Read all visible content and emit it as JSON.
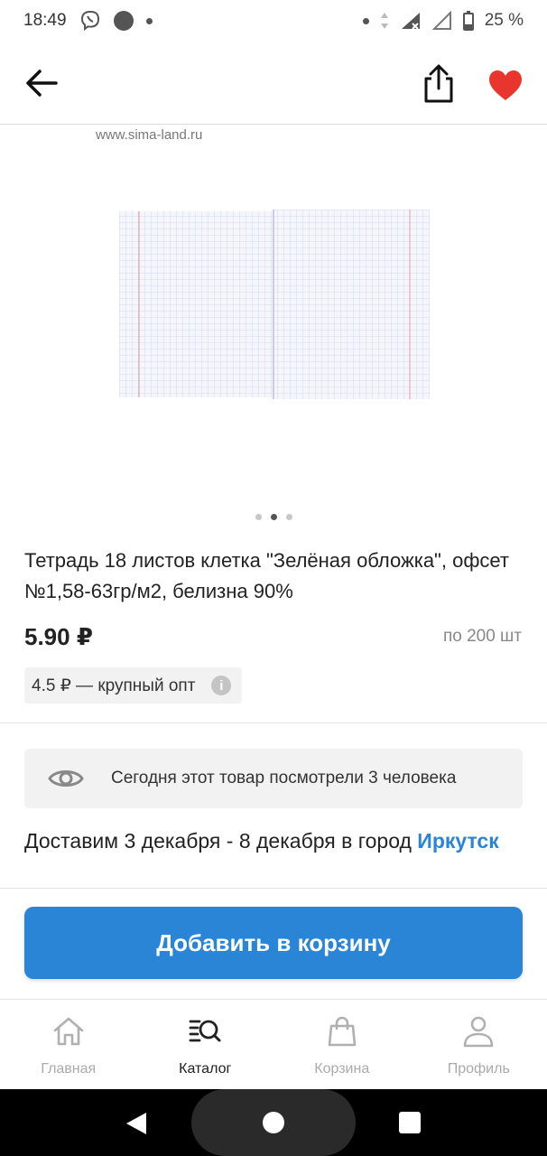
{
  "status_bar": {
    "time": "18:49",
    "battery": "25 %"
  },
  "gallery": {
    "watermark": "www.sima-land.ru",
    "pages": 3,
    "active_page": 2
  },
  "product": {
    "title": "Тетрадь 18 листов клетка \"Зелёная обложка\", офсет №1,58-63гр/м2, белизна 90%",
    "price": "5.90 ₽",
    "pack": "по 200 шт",
    "wholesale": "4.5 ₽ — крупный опт"
  },
  "views_notice": "Сегодня этот товар посмотрели 3 человека",
  "delivery": {
    "text": "Доставим 3 декабря - 8 декабря в город",
    "city": "Иркутск"
  },
  "add_to_cart": "Добавить в корзину",
  "bottom_nav": {
    "items": [
      {
        "label": "Главная",
        "icon": "home-icon"
      },
      {
        "label": "Каталог",
        "icon": "catalog-search-icon",
        "active": true
      },
      {
        "label": "Корзина",
        "icon": "shopping-bag-icon"
      },
      {
        "label": "Профиль",
        "icon": "user-icon"
      }
    ]
  },
  "colors": {
    "accent": "#2a85d6",
    "favorite": "#e8362f"
  }
}
